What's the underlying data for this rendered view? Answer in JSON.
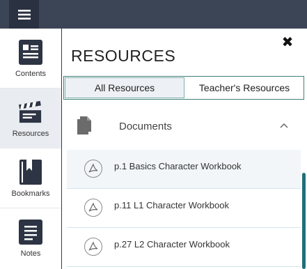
{
  "sidebar": {
    "items": [
      {
        "label": "Contents",
        "icon": "contents-icon"
      },
      {
        "label": "Resources",
        "icon": "clapperboard-icon",
        "active": true
      },
      {
        "label": "Bookmarks",
        "icon": "bookmark-icon"
      },
      {
        "label": "Notes",
        "icon": "notes-icon"
      }
    ]
  },
  "panel": {
    "title": "RESOURCES",
    "tabs": [
      {
        "label": "All Resources",
        "active": true
      },
      {
        "label": "Teacher's Resources",
        "active": false
      }
    ],
    "section": {
      "label": "Documents",
      "icon": "documents-icon",
      "expanded": true
    },
    "items": [
      {
        "label": "p.1 Basics Character Workbook",
        "icon": "pdf-icon"
      },
      {
        "label": "p.11 L1 Character Workbook",
        "icon": "pdf-icon"
      },
      {
        "label": "p.27 L2 Character Workbook",
        "icon": "pdf-icon"
      }
    ]
  },
  "colors": {
    "topbar": "#3c4556",
    "accent": "#1f6f7c"
  }
}
